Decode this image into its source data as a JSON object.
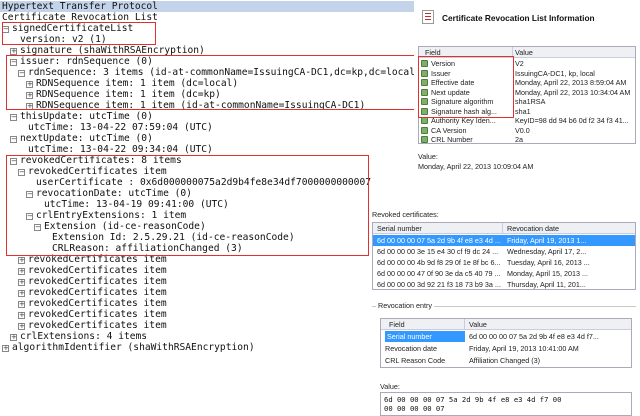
{
  "tree": {
    "header": "Hypertext Transfer Protocol",
    "rows": [
      {
        "indent": 0,
        "toggle": "",
        "text": "Certificate Revocation List"
      },
      {
        "indent": 0,
        "toggle": "−",
        "text": "signedCertificateList"
      },
      {
        "indent": 2,
        "toggle": "",
        "text": "version: v2 (1)"
      },
      {
        "indent": 1,
        "toggle": "+",
        "text": "signature (shaWithRSAEncryption)"
      },
      {
        "indent": 1,
        "toggle": "−",
        "text": "issuer: rdnSequence (0)"
      },
      {
        "indent": 2,
        "toggle": "−",
        "text": "rdnSequence: 3 items (id-at-commonName=IssuingCA-DC1,dc=kp,dc=local)"
      },
      {
        "indent": 3,
        "toggle": "+",
        "text": "RDNSequence item: 1 item (dc=local)"
      },
      {
        "indent": 3,
        "toggle": "+",
        "text": "RDNSequence item: 1 item (dc=kp)"
      },
      {
        "indent": 3,
        "toggle": "+",
        "text": "RDNSequence item: 1 item (id-at-commonName=IssuingCA-DC1)"
      },
      {
        "indent": 1,
        "toggle": "−",
        "text": "thisUpdate: utcTime (0)"
      },
      {
        "indent": 3,
        "toggle": "",
        "text": "utcTime: 13-04-22 07:59:04 (UTC)"
      },
      {
        "indent": 1,
        "toggle": "−",
        "text": "nextUpdate: utcTime (0)"
      },
      {
        "indent": 3,
        "toggle": "",
        "text": "utcTime: 13-04-22 09:34:04 (UTC)"
      },
      {
        "indent": 1,
        "toggle": "−",
        "text": "revokedCertificates: 8 items"
      },
      {
        "indent": 2,
        "toggle": "−",
        "text": "revokedCertificates item"
      },
      {
        "indent": 4,
        "toggle": "",
        "text": "userCertificate : 0x6d000000075a2d9b4fe8e34df7000000000007"
      },
      {
        "indent": 3,
        "toggle": "−",
        "text": "revocationDate: utcTime (0)"
      },
      {
        "indent": 5,
        "toggle": "",
        "text": "utcTime: 13-04-19 09:41:00 (UTC)"
      },
      {
        "indent": 3,
        "toggle": "−",
        "text": "crlEntryExtensions: 1 item"
      },
      {
        "indent": 4,
        "toggle": "−",
        "text": "Extension (id-ce-reasonCode)"
      },
      {
        "indent": 6,
        "toggle": "",
        "text": "Extension Id: 2.5.29.21 (id-ce-reasonCode)"
      },
      {
        "indent": 6,
        "toggle": "",
        "text": "CRLReason: affiliationChanged (3)"
      },
      {
        "indent": 2,
        "toggle": "+",
        "text": "revokedCertificates item"
      },
      {
        "indent": 2,
        "toggle": "+",
        "text": "revokedCertificates item"
      },
      {
        "indent": 2,
        "toggle": "+",
        "text": "revokedCertificates item"
      },
      {
        "indent": 2,
        "toggle": "+",
        "text": "revokedCertificates item"
      },
      {
        "indent": 2,
        "toggle": "+",
        "text": "revokedCertificates item"
      },
      {
        "indent": 2,
        "toggle": "+",
        "text": "revokedCertificates item"
      },
      {
        "indent": 2,
        "toggle": "+",
        "text": "revokedCertificates item"
      },
      {
        "indent": 1,
        "toggle": "+",
        "text": "crlExtensions: 4 items"
      },
      {
        "indent": 0,
        "toggle": "+",
        "text": "algorithmIdentifier (shaWithRSAEncryption)"
      }
    ]
  },
  "dialog": {
    "title": "Certificate Revocation List Information",
    "fields_grid": {
      "columns": [
        "Field",
        "Value"
      ],
      "rows": [
        {
          "field": "Version",
          "value": "V2"
        },
        {
          "field": "Issuer",
          "value": "IssuingCA-DC1, kp, local"
        },
        {
          "field": "Effective date",
          "value": "Monday, April 22, 2013 8:59:04 AM"
        },
        {
          "field": "Next update",
          "value": "Monday, April 22, 2013 10:34:04 AM"
        },
        {
          "field": "Signature algorithm",
          "value": "sha1RSA"
        },
        {
          "field": "Signature hash alg...",
          "value": "sha1"
        },
        {
          "field": "Authority Key Iden...",
          "value": "KeyID=98 dd 94 b6 0d f2 34 f3 41..."
        },
        {
          "field": "CA Version",
          "value": "V0.0"
        },
        {
          "field": "CRL Number",
          "value": "2a"
        },
        {
          "field": "",
          "value": ""
        }
      ],
      "selected_index": 9
    },
    "value_label": "Value:",
    "value_text": "Monday, April 22, 2013 10:09:04 AM",
    "revoked": {
      "label": "Revoked certificates:",
      "columns": [
        "Serial number",
        "Revocation date"
      ],
      "rows": [
        {
          "serial": "6d 00 00 00 07 5a 2d 9b 4f e8 e3 4d ...",
          "date": "Friday, April 19, 2013 1..."
        },
        {
          "serial": "6d 00 00 00 3e 15 e4 30 cf f9 dc 24 ...",
          "date": "Wednesday, April 17, 2..."
        },
        {
          "serial": "6d 00 00 00 4b 9d f8 29 0f 1e 8f bc 6...",
          "date": "Tuesday, April 16, 2013 ..."
        },
        {
          "serial": "6d 00 00 00 47 0f 90 3e da c5 40 79 ...",
          "date": "Monday, April 15, 2013 ..."
        },
        {
          "serial": "6d 00 00 00 3d 92 21 f3 18 73 b9 3a ...",
          "date": "Thursday, April 11, 201..."
        }
      ],
      "selected_index": 0
    },
    "entry": {
      "label": "Revocation entry",
      "columns": [
        "Field",
        "Value"
      ],
      "rows": [
        {
          "field": "Serial number",
          "value": "6d 00 00 00 07 5a 2d 9b 4f e8 e3 4d f7..."
        },
        {
          "field": "Revocation date",
          "value": "Friday, April 19, 2013 10:41:00 AM"
        },
        {
          "field": "CRL Reason Code",
          "value": "Affiliation Changed (3)"
        }
      ],
      "selected_index": 0
    },
    "entry_value_label": "Value:",
    "entry_value_lines": [
      "6d 00 00 00 07 5a 2d 9b 4f e8 e3 4d f7 00",
      "00 00 00 00 07"
    ]
  },
  "colors": {
    "highlight": "#e03030",
    "selection": "#3399ff",
    "header_bar": "#c3d3ea"
  }
}
